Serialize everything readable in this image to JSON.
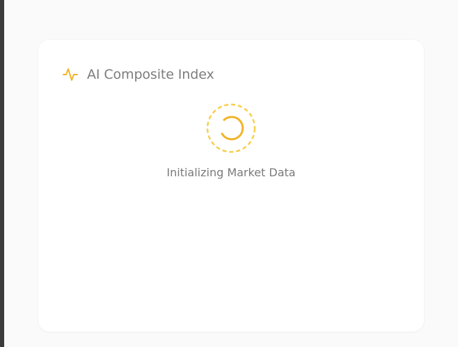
{
  "card": {
    "title": "AI Composite Index",
    "icon": "activity-pulse-icon",
    "loading_text": "Initializing Market Data",
    "loading_icon": "spinner-icon"
  },
  "colors": {
    "accent": "#f0b429",
    "accent_light": "#f7cf4d",
    "title_text": "#7c7c7c",
    "page_background": "#fafafa",
    "card_background": "#ffffff"
  }
}
